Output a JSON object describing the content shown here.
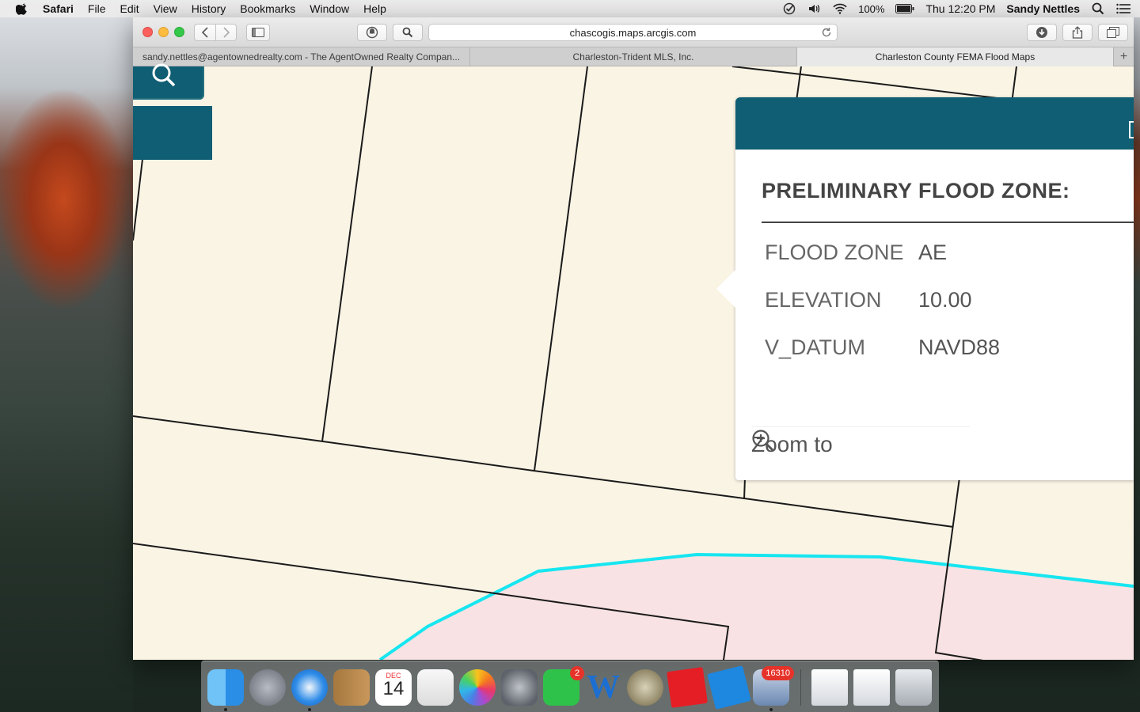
{
  "menubar": {
    "app_name": "Safari",
    "items": [
      "File",
      "Edit",
      "View",
      "History",
      "Bookmarks",
      "Window",
      "Help"
    ],
    "battery": "100%",
    "clock": "Thu 12:20 PM",
    "user": "Sandy Nettles"
  },
  "browser": {
    "address": "chascogis.maps.arcgis.com",
    "tabs": [
      {
        "label": "sandy.nettles@agentownedrealty.com - The AgentOwned Realty Compan..."
      },
      {
        "label": "Charleston-Trident MLS, Inc."
      },
      {
        "label": "Charleston County FEMA Flood Maps"
      }
    ],
    "new_tab_symbol": "+"
  },
  "popup": {
    "title": "PRELIMINARY FLOOD ZONE:",
    "attributes": [
      {
        "label": "FLOOD ZONE",
        "value": "AE"
      },
      {
        "label": "ELEVATION",
        "value": "10.00"
      },
      {
        "label": "V_DATUM",
        "value": "NAVD88"
      }
    ],
    "zoom_label": "Zoom to"
  },
  "dock": {
    "calendar_month": "DEC",
    "calendar_day": "14",
    "facetime_badge": "2",
    "mail_badge": "16310"
  },
  "colors": {
    "map_bg": "#faf4e5",
    "flood_fill": "#f9e2e3",
    "flood_line": "#16e6f0",
    "popup_header": "#0f5e73",
    "parcel_line": "#1a1a1a"
  }
}
